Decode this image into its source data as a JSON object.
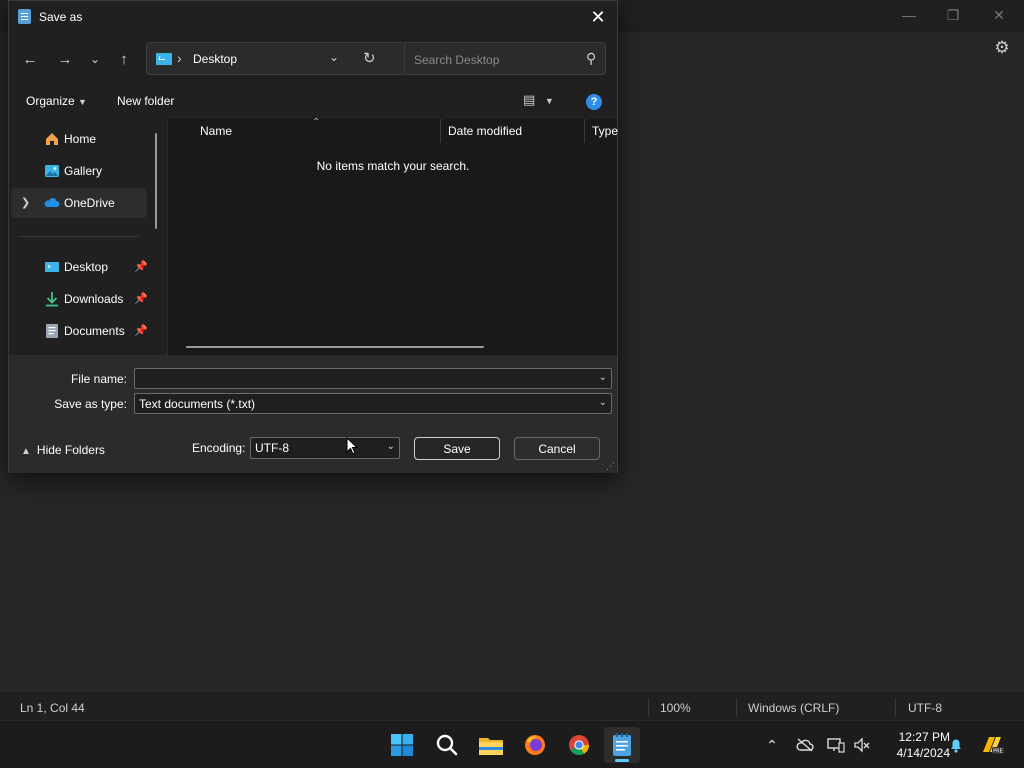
{
  "dialog": {
    "title": "Save as",
    "address": {
      "location": "Desktop"
    },
    "search": {
      "placeholder": "Search Desktop"
    },
    "toolbar": {
      "organize": "Organize",
      "new_folder": "New folder"
    },
    "nav_items": [
      {
        "label": "Home",
        "icon": "home-icon"
      },
      {
        "label": "Gallery",
        "icon": "gallery-icon"
      },
      {
        "label": "OneDrive",
        "icon": "onedrive-icon",
        "selected": true
      },
      {
        "label": "Desktop",
        "icon": "desktop-icon",
        "pinned": true
      },
      {
        "label": "Downloads",
        "icon": "downloads-icon",
        "pinned": true
      },
      {
        "label": "Documents",
        "icon": "documents-icon",
        "pinned": true
      }
    ],
    "columns": [
      "Name",
      "Date modified",
      "Type"
    ],
    "empty_message": "No items match your search.",
    "file_name": {
      "label": "File name:",
      "value": ""
    },
    "save_type": {
      "label": "Save as type:",
      "value": "Text documents (*.txt)"
    },
    "hide_folders": "Hide Folders",
    "encoding": {
      "label": "Encoding:",
      "value": "UTF-8"
    },
    "buttons": {
      "save": "Save",
      "cancel": "Cancel"
    }
  },
  "statusbar": {
    "position": "Ln 1, Col 44",
    "zoom": "100%",
    "line_ending": "Windows (CRLF)",
    "encoding": "UTF-8"
  },
  "taskbar": {
    "apps": [
      "start-icon",
      "search-icon",
      "file-explorer-icon",
      "firefox-icon",
      "chrome-icon",
      "notepad-icon"
    ],
    "clock": {
      "time": "12:27 PM",
      "date": "4/14/2024"
    }
  },
  "colors": {
    "accent": "#60cdff",
    "help": "#2f8de8",
    "desktop_folder": "#3ab4e6"
  }
}
